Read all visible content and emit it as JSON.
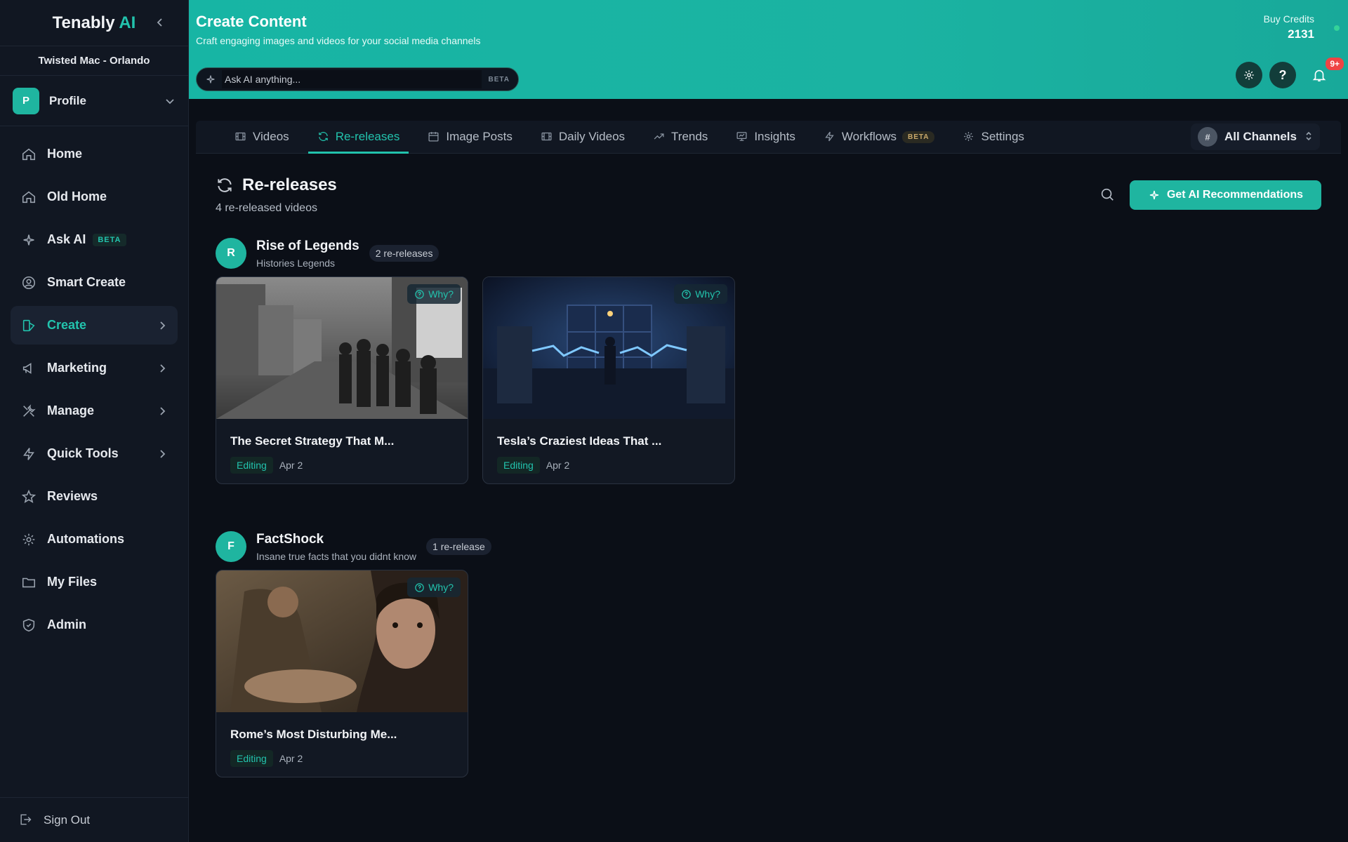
{
  "brand": {
    "name": "Tenably",
    "suffix": "AI"
  },
  "org": "Twisted Mac - Orlando",
  "profile": {
    "initial": "P",
    "label": "Profile"
  },
  "nav": [
    {
      "label": "Home",
      "icon": "home-icon"
    },
    {
      "label": "Old Home",
      "icon": "home-icon"
    },
    {
      "label": "Ask AI",
      "icon": "sparkle-icon",
      "badge": "BETA"
    },
    {
      "label": "Smart Create",
      "icon": "user-circle-icon"
    },
    {
      "label": "Create",
      "icon": "create-icon",
      "active": true,
      "chevron": true
    },
    {
      "label": "Marketing",
      "icon": "megaphone-icon",
      "chevron": true
    },
    {
      "label": "Manage",
      "icon": "tools-icon",
      "chevron": true
    },
    {
      "label": "Quick Tools",
      "icon": "bolt-icon",
      "chevron": true
    },
    {
      "label": "Reviews",
      "icon": "star-icon"
    },
    {
      "label": "Automations",
      "icon": "gear-icon"
    },
    {
      "label": "My Files",
      "icon": "folder-icon"
    },
    {
      "label": "Admin",
      "icon": "shield-icon"
    }
  ],
  "sign_out": "Sign Out",
  "header": {
    "title": "Create Content",
    "subtitle": "Craft engaging images and videos for your social media channels",
    "ask_placeholder": "Ask AI anything...",
    "ask_beta": "BETA",
    "credits_label": "Buy Credits",
    "credits_value": "2131",
    "help": "?",
    "notifications": "9+"
  },
  "tabs": [
    {
      "label": "Videos",
      "icon": "film-icon"
    },
    {
      "label": "Re-releases",
      "icon": "refresh-icon",
      "active": true
    },
    {
      "label": "Image Posts",
      "icon": "calendar-icon"
    },
    {
      "label": "Daily Videos",
      "icon": "film-icon"
    },
    {
      "label": "Trends",
      "icon": "trend-icon"
    },
    {
      "label": "Insights",
      "icon": "presentation-icon"
    },
    {
      "label": "Workflows",
      "icon": "bolt-icon",
      "badge": "BETA"
    },
    {
      "label": "Settings",
      "icon": "gear-icon"
    }
  ],
  "channel_select": {
    "hash": "#",
    "label": "All Channels"
  },
  "section": {
    "title": "Re-releases",
    "subtitle": "4 re-released videos",
    "ai_button": "Get AI Recommendations"
  },
  "groups": [
    {
      "initial": "R",
      "name": "Rise of Legends",
      "desc": "Histories Legends",
      "count": "2 re-releases",
      "cards": [
        {
          "title": "The Secret Strategy That M...",
          "status": "Editing",
          "date": "Apr 2",
          "why": "Why?"
        },
        {
          "title": "Tesla’s Craziest Ideas That ...",
          "status": "Editing",
          "date": "Apr 2",
          "why": "Why?"
        }
      ]
    },
    {
      "initial": "F",
      "name": "FactShock",
      "desc": "Insane true facts that you didnt know",
      "count": "1 re-release",
      "cards": [
        {
          "title": "Rome’s Most Disturbing Me...",
          "status": "Editing",
          "date": "Apr 2",
          "why": "Why?"
        }
      ]
    }
  ],
  "colors": {
    "accent": "#22c3ad",
    "header": "#18b3a2",
    "bg": "#0b0f17",
    "badge": "#ef4444"
  }
}
